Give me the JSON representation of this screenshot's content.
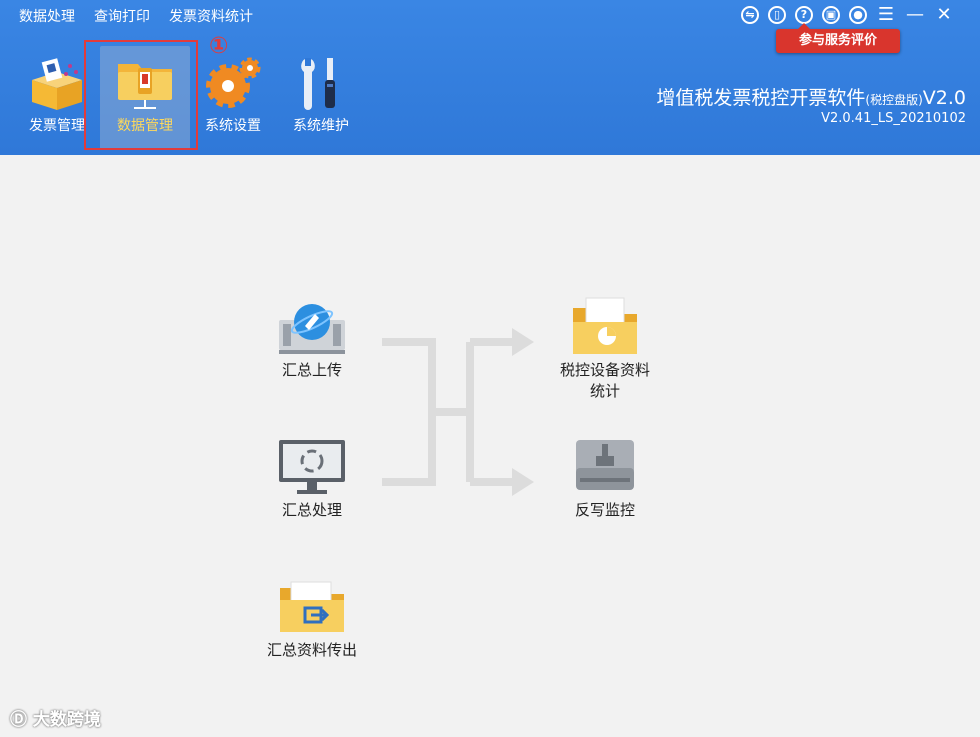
{
  "menu": [
    "数据处理",
    "查询打印",
    "发票资料统计"
  ],
  "window_controls": [
    {
      "name": "exchange-icon",
      "glyph": "⇋"
    },
    {
      "name": "service-icon",
      "glyph": "▯"
    },
    {
      "name": "help-icon",
      "glyph": "?"
    },
    {
      "name": "lock-icon",
      "glyph": "▣"
    },
    {
      "name": "user-icon",
      "glyph": "●"
    },
    {
      "name": "hamburger-menu-icon",
      "glyph": "☰"
    },
    {
      "name": "minimize-icon",
      "glyph": "—"
    },
    {
      "name": "close-icon",
      "glyph": "✕"
    }
  ],
  "rating_button": "参与服务评价",
  "toolbar": {
    "invoice_mgmt": "发票管理",
    "data_mgmt": "数据管理",
    "system_settings": "系统设置",
    "system_maintenance": "系统维护"
  },
  "annotation_marker": "①",
  "app": {
    "title_main": "增值税发票税控开票软件",
    "title_edition": "(税控盘版)",
    "title_version": "V2.0",
    "version": "V2.0.41_LS_20210102"
  },
  "functions": {
    "summary_upload": "汇总上传",
    "summary_process": "汇总处理",
    "summary_export": "汇总资料传出",
    "device_stats_line1": "税控设备资料",
    "device_stats_line2": "统计",
    "writeback_monitor": "反写监控"
  },
  "watermark": "大数跨境",
  "colors": {
    "topbar": "#2f78d8",
    "highlight": "#e23b3b",
    "rating": "#d9352d",
    "folder": "#f5c24a"
  }
}
